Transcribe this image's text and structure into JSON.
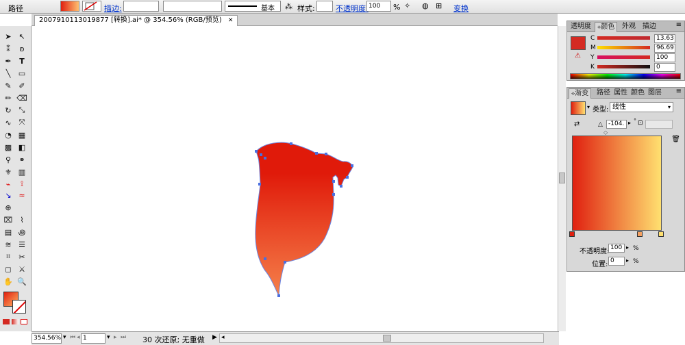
{
  "control": {
    "path_label": "路径",
    "stroke_link": "描边:",
    "stroke_style": "基本",
    "style_label": "样式:",
    "opacity_link": "不透明度:",
    "opacity_value": "100",
    "pct": "%",
    "transform_link": "变换"
  },
  "doc": {
    "tab_title": "2007910113019877 [转换].ai* @ 354.56% (RGB/预览)",
    "close": "✕"
  },
  "status": {
    "zoom": "354.56%",
    "page": "1",
    "message": "30 次还原; 无重做"
  },
  "color_panel": {
    "tabs": [
      "透明度",
      "颜色",
      "外观",
      "描边"
    ],
    "channels": [
      {
        "label": "C",
        "value": "13.63"
      },
      {
        "label": "M",
        "value": "96.69"
      },
      {
        "label": "Y",
        "value": "100"
      },
      {
        "label": "K",
        "value": "0"
      }
    ],
    "swatch_color": "#d42a22"
  },
  "gradient_panel": {
    "tabs": [
      "渐变",
      "路径",
      "属性",
      "颜色",
      "图层"
    ],
    "type_label": "类型:",
    "type_value": "线性",
    "angle_value": "-104.",
    "opacity_label": "不透明度:",
    "opacity_value": "100",
    "pct": "%",
    "position_label": "位置:",
    "position_value": "0",
    "start_color": "#e02010",
    "end_color": "#ffe070"
  },
  "colors": {
    "shape_top": "#e01a0a",
    "shape_bottom": "#f5804a",
    "anchor": "#4a6fe0"
  }
}
